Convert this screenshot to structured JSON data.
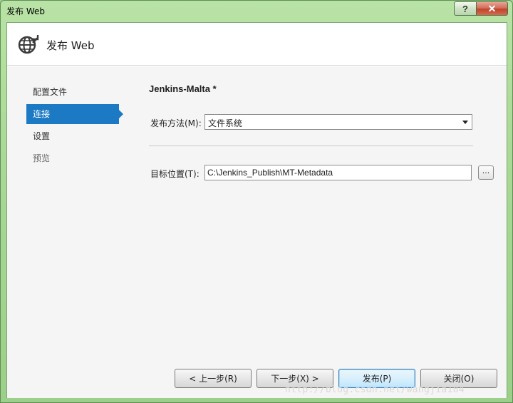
{
  "window": {
    "title": "发布 Web",
    "help_label": "?",
    "close_label": "✕"
  },
  "header": {
    "title": "发布 Web",
    "icon": "globe-publish-icon"
  },
  "nav": {
    "items": [
      {
        "label": "配置文件",
        "state": "normal"
      },
      {
        "label": "连接",
        "state": "active"
      },
      {
        "label": "设置",
        "state": "normal"
      },
      {
        "label": "预览",
        "state": "muted"
      }
    ]
  },
  "main": {
    "profile_title": "Jenkins-Malta *",
    "publish_method_label": "发布方法(M):",
    "publish_method_value": "文件系统",
    "target_location_label": "目标位置(T):",
    "target_location_value": "C:\\Jenkins_Publish\\MT-Metadata",
    "browse_label": "..."
  },
  "buttons": {
    "prev": "< 上一步(R)",
    "next": "下一步(X) >",
    "publish": "发布(P)",
    "close": "关闭(O)"
  },
  "watermark": "http://blog.csdn.net/wangjia184",
  "colors": {
    "accent": "#1b7ac3",
    "frame": "#a9d897"
  }
}
